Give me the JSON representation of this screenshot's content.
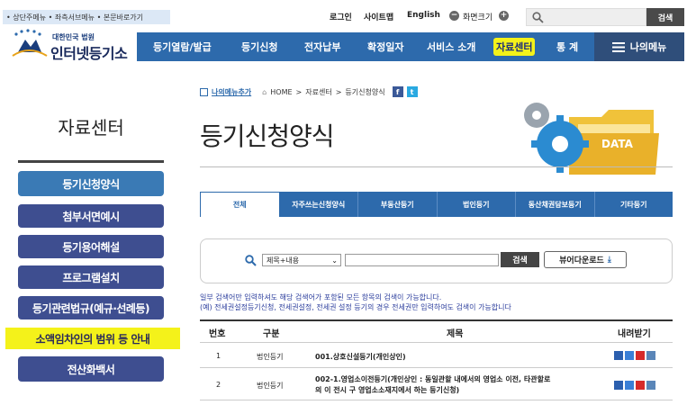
{
  "skip_links": "• 상단주메뉴 • 좌측서브메뉴 • 본문바로가기",
  "util": {
    "login": "로그인",
    "sitemap": "사이트맵",
    "english": "English",
    "zoom_label": "화면크기",
    "minus": "−",
    "plus": "+"
  },
  "search": {
    "button": "검색",
    "placeholder": ""
  },
  "logo": {
    "sub": "대한민국 법원",
    "main": "인터넷등기소"
  },
  "nav": {
    "items": [
      "등기열람/발급",
      "등기신청",
      "전자납부",
      "확정일자",
      "서비스 소개",
      "자료센터",
      "통 계"
    ],
    "mymenu": "나의메뉴"
  },
  "sidebar": {
    "title": "자료센터",
    "items": [
      "등기신청양식",
      "첨부서면예시",
      "등기용어해설",
      "프로그램설치",
      "등기관련법규(예규·선례등)",
      "소액임차인의 범위 등 안내",
      "전산화백서"
    ]
  },
  "crumb": {
    "mymenu_add": "나의메뉴추가",
    "home": "HOME",
    "sep": ">",
    "path1": "자료센터",
    "path2": "등기신청양식",
    "fb": "f",
    "tw": "t"
  },
  "page_title": "등기신청양식",
  "illustration_label": "DATA",
  "tabs": [
    "전체",
    "자주쓰는신청양식",
    "부동산등기",
    "법인등기",
    "동산채권담보등기",
    "기타등기"
  ],
  "filter": {
    "select_value": "제목+내용",
    "search_button": "검색",
    "view_download": "뷰어다운로드"
  },
  "notes": [
    "일부 검색어만 입력하셔도 해당 검색어가 포함된 모든 항목의 검색이 가능합니다.",
    "(예) 전세권설정등기신청, 전세권설정, 전세권 설정 등기의 경우 전세권만 입력하여도 검색이 가능합니다"
  ],
  "table": {
    "headers": [
      "번호",
      "구분",
      "제목",
      "내려받기"
    ],
    "rows": [
      {
        "no": "1",
        "type": "법인등기",
        "title1": "001.상호신설등기(개인상인)",
        "title2": ""
      },
      {
        "no": "2",
        "type": "법인등기",
        "title1": "002-1.영업소이전등기(개인상인 : 동일관할 내에서의 영업소 이전, 타관할로",
        "title2": "의 이 전시 구 영업소소재지에서 하는 등기신청)"
      }
    ]
  },
  "colors": {
    "nav": "#2d6aac",
    "sidebar": "#3e4e90",
    "highlight": "#f4f21a",
    "note": "#2a3c9c"
  }
}
